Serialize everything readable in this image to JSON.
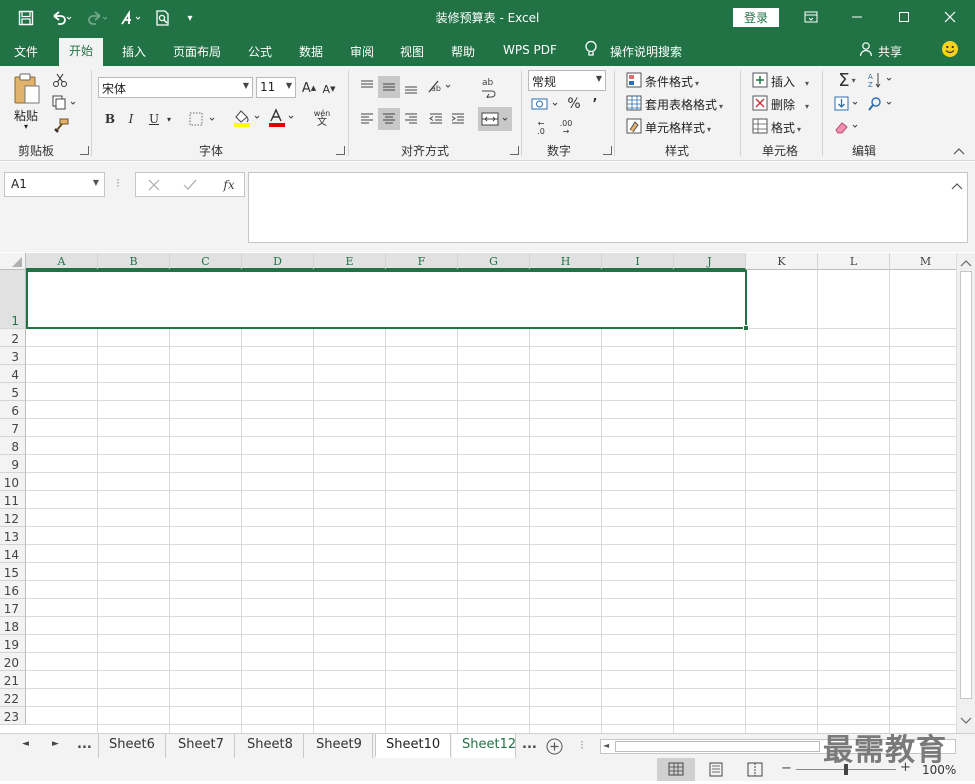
{
  "window": {
    "title": "装修预算表  -  Excel",
    "login_label": "登录"
  },
  "menu": {
    "items": [
      "文件",
      "开始",
      "插入",
      "页面布局",
      "公式",
      "数据",
      "审阅",
      "视图",
      "帮助",
      "WPS PDF",
      "操作说明搜索"
    ],
    "active": "开始",
    "share_label": "共享"
  },
  "ribbon": {
    "paste_label": "粘贴",
    "groups": [
      "剪贴板",
      "字体",
      "对齐方式",
      "数字",
      "样式",
      "单元格",
      "编辑"
    ],
    "font_name": "宋体",
    "font_size": "11",
    "number_format": "常规",
    "bold": "B",
    "italic": "I",
    "underline": "U",
    "increase_font": "A",
    "decrease_font": "A",
    "wen_label": "wén",
    "wen_char": "文",
    "percent": "%",
    "comma": "’",
    "inc_dec": ".0",
    "dec_dec": ".00",
    "conditional_format": "条件格式",
    "table_format": "套用表格格式",
    "cell_styles": "单元格样式",
    "insert_cells": "插入",
    "delete_cells": "删除",
    "format_cells": "格式",
    "sigma": "Σ"
  },
  "formula_bar": {
    "name_box": "A1",
    "fx": "fx"
  },
  "grid": {
    "columns": [
      "A",
      "B",
      "C",
      "D",
      "E",
      "F",
      "G",
      "H",
      "I",
      "J",
      "K",
      "L",
      "M"
    ],
    "rows": [
      "1",
      "2",
      "3",
      "4",
      "5",
      "6",
      "7",
      "8",
      "9",
      "10",
      "11",
      "12",
      "13",
      "14",
      "15",
      "16",
      "17",
      "18",
      "19",
      "20",
      "21",
      "22",
      "23"
    ]
  },
  "tabs": {
    "nav_more": "...",
    "sheets": [
      "Sheet6",
      "Sheet7",
      "Sheet8",
      "Sheet9",
      "Sheet10",
      "Sheet12"
    ],
    "active": "Sheet10",
    "more_after": "..."
  },
  "status": {
    "zoom": "100%",
    "minus": "−",
    "plus": "+"
  },
  "watermark": "最需教育",
  "colors": {
    "accent": "#217346",
    "ribbon_bg": "#f3f3f3"
  }
}
